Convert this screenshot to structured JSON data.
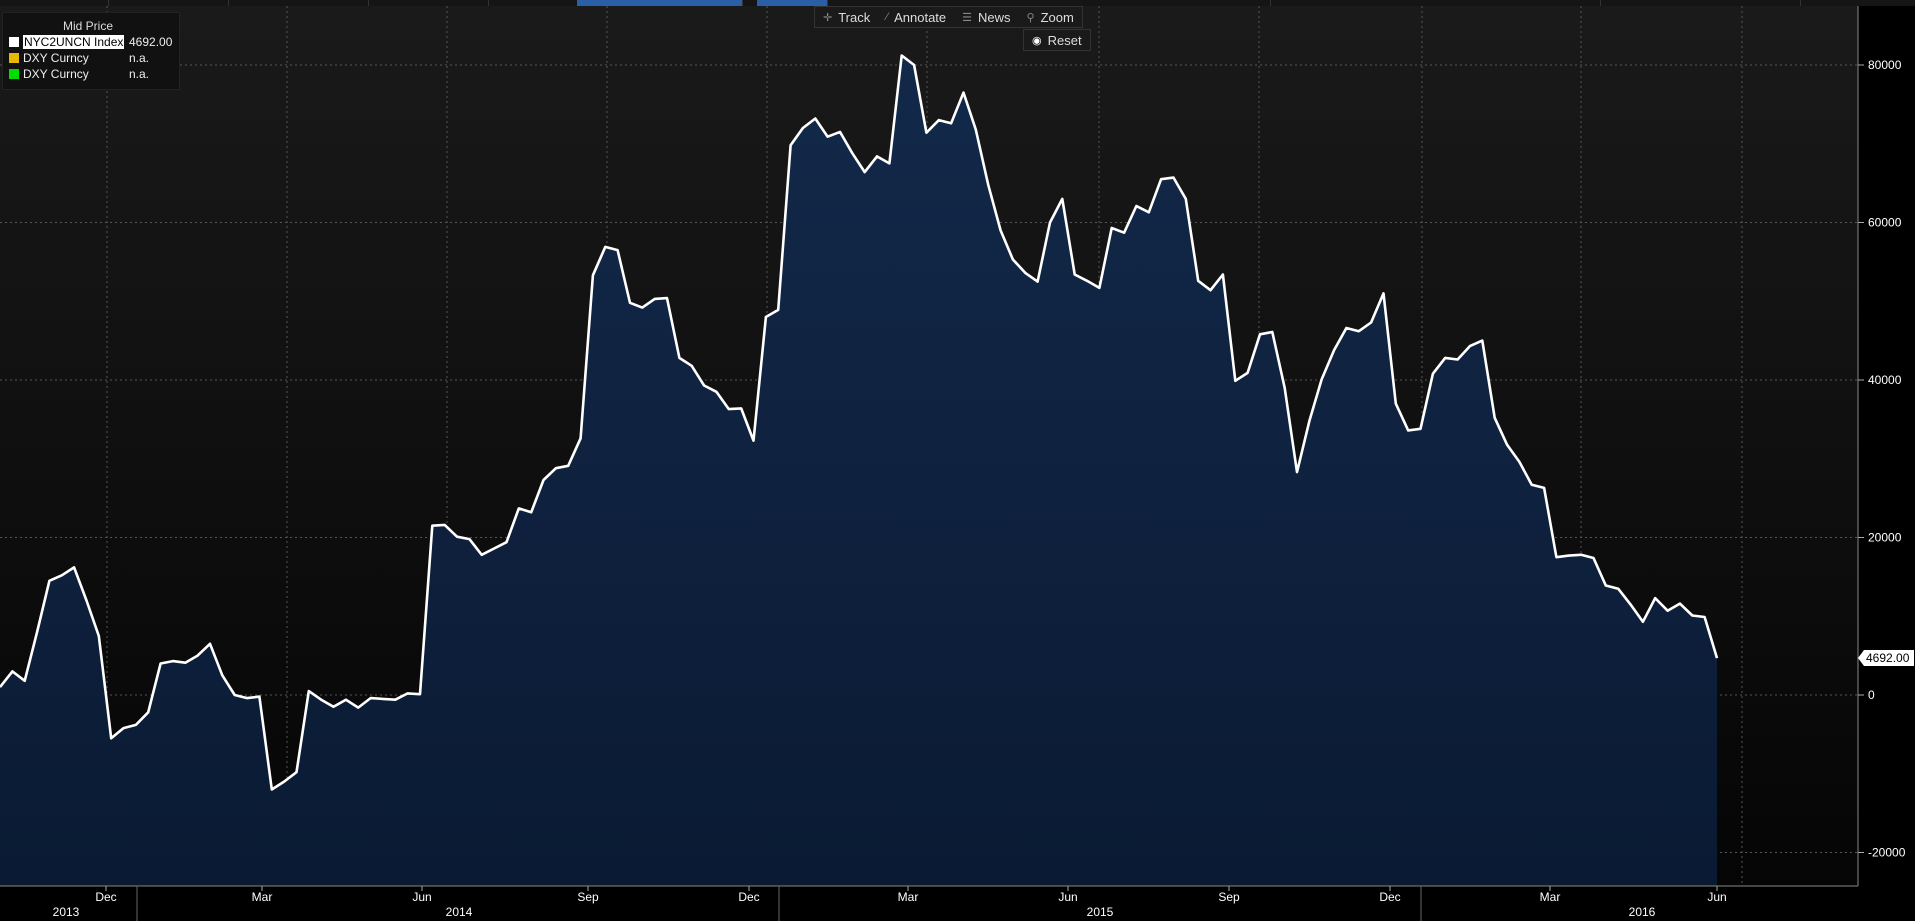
{
  "toolbar": {
    "track_label": "Track",
    "annotate_label": "Annotate",
    "news_label": "News",
    "zoom_label": "Zoom",
    "reset_label": "Reset"
  },
  "legend": {
    "header": "Mid Price",
    "items": [
      {
        "name": "NYC2UNCN Index",
        "value": "4692.00",
        "color": "#ffffff"
      },
      {
        "name": "DXY Curncy",
        "value": "n.a.",
        "color": "#e6b800"
      },
      {
        "name": "DXY Curncy",
        "value": "n.a.",
        "color": "#00dd00"
      }
    ]
  },
  "last_value_label": "4692.00",
  "colors": {
    "line": "#ffffff",
    "fill_top": "#13294a",
    "fill_bottom": "#0a1a33",
    "background": "#000000",
    "grid": "#555555"
  },
  "chart_data": {
    "type": "area",
    "ylim": [
      -24000,
      86000
    ],
    "y_ticks": [
      -20000,
      0,
      20000,
      40000,
      60000,
      80000
    ],
    "y_tick_labels": [
      "-20000",
      "0",
      "20000",
      "40000",
      "60000",
      "80000"
    ],
    "x_month_ticks": [
      "Dec",
      "Mar",
      "Jun",
      "Sep",
      "Dec",
      "Mar",
      "Jun",
      "Sep",
      "Dec",
      "Mar",
      "Jun"
    ],
    "x_year_labels": [
      "2013",
      "2014",
      "2015",
      "2016"
    ],
    "grid": true,
    "series": [
      {
        "values": [
          1000,
          3000,
          1800,
          8000,
          14500,
          15200,
          16200,
          12000,
          7500,
          -5500,
          -4200,
          -3800,
          -2200,
          4000,
          4300,
          4100,
          5000,
          6500,
          2500,
          0,
          -400,
          -200,
          -12000,
          -11000,
          -9800,
          500,
          -600,
          -1500,
          -600,
          -1600,
          -400,
          -500,
          -600,
          200,
          100,
          21500,
          21600,
          20100,
          19800,
          17800,
          18600,
          19400,
          23700,
          23200,
          27300,
          28800,
          29100,
          32600,
          53300,
          56900,
          56500,
          49800,
          49200,
          50300,
          50400,
          42800,
          41800,
          39300,
          38500,
          36300,
          36400,
          32300,
          48000,
          48900,
          69800,
          72000,
          73200,
          70900,
          71500,
          68800,
          66400,
          68400,
          67500,
          81200,
          80000,
          71400,
          73000,
          72600,
          76500,
          71800,
          64800,
          59000,
          55300,
          53600,
          52500,
          60000,
          63000,
          53400,
          52600,
          51700,
          59300,
          58700,
          62100,
          61300,
          65500,
          65700,
          63000,
          52600,
          51400,
          53400,
          39900,
          40900,
          45800,
          46100,
          39000,
          28300,
          34800,
          40100,
          43800,
          46600,
          46200,
          47300,
          51000,
          37000,
          33600,
          33800,
          40800,
          42800,
          42600,
          44300,
          45000,
          35200,
          31800,
          29600,
          26700,
          26300,
          17500,
          17700,
          17800,
          17400,
          13900,
          13500,
          11500,
          9300,
          12300,
          10700,
          11600,
          10100,
          9900,
          4692
        ]
      }
    ]
  }
}
